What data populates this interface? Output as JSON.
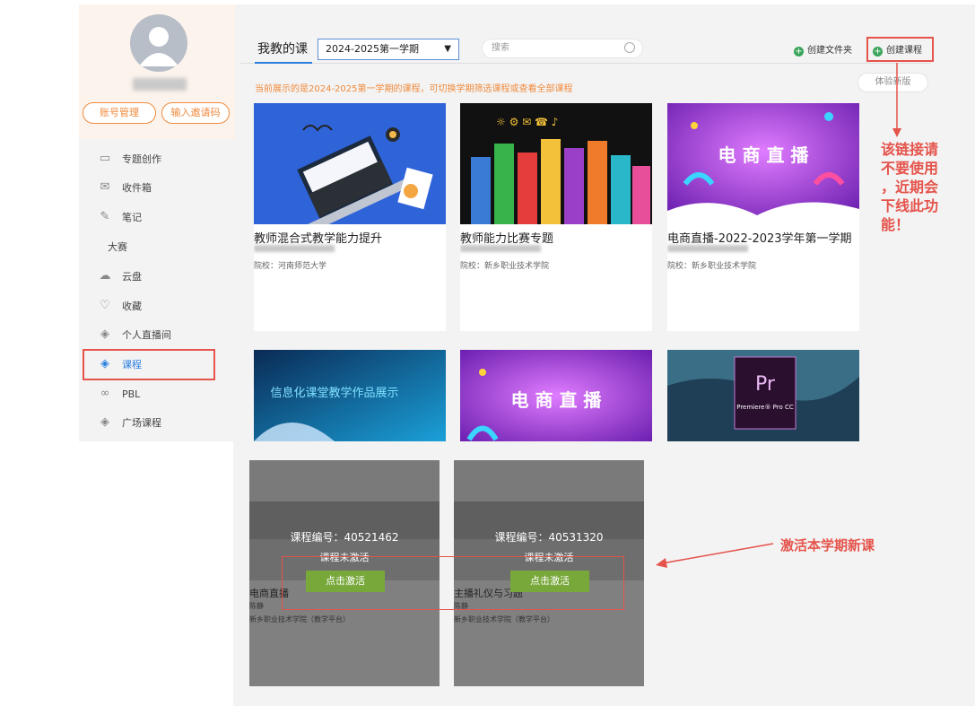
{
  "sidebar": {
    "account_btn": "账号管理",
    "invite_btn": "输入邀请码",
    "items": [
      {
        "label": "专题创作",
        "icon": "monitor-icon"
      },
      {
        "label": "收件箱",
        "icon": "inbox-icon"
      },
      {
        "label": "笔记",
        "icon": "note-icon"
      },
      {
        "label": "大赛",
        "icon": ""
      },
      {
        "label": "云盘",
        "icon": "cloud-icon"
      },
      {
        "label": "收藏",
        "icon": "heart-icon"
      },
      {
        "label": "个人直播间",
        "icon": "live-icon"
      },
      {
        "label": "课程",
        "icon": "course-icon"
      },
      {
        "label": "PBL",
        "icon": "group-icon"
      },
      {
        "label": "广场课程",
        "icon": "square-icon"
      }
    ]
  },
  "header": {
    "tab": "我教的课",
    "semester": "2024-2025第一学期",
    "search_placeholder": "搜索",
    "create_folder": "创建文件夹",
    "create_course": "创建课程",
    "notice": "当前展示的是2024-2025第一学期的课程，可切换学期筛选课程或查看全部课程",
    "try_new": "体验新版"
  },
  "courses": [
    {
      "title": "教师混合式教学能力提升",
      "school": "院校：河南师范大学"
    },
    {
      "title": "教师能力比赛专题",
      "school": "院校：新乡职业技术学院"
    },
    {
      "title": "电商直播-2022-2023学年第一学期",
      "school": "院校：新乡职业技术学院"
    }
  ],
  "course_images": {
    "card1": "",
    "card2": "",
    "card3": "电 商 直 播",
    "card4": "信息化课堂教学作品展示",
    "card5": "电 商 直 播",
    "card6_logo": "Pr",
    "card6_text": "Premiere® Pro CC"
  },
  "inactive_courses": [
    {
      "code": "课程编号：40521462",
      "status": "课程未激活",
      "button": "点击激活",
      "title": "电商直播",
      "teacher": "陈静",
      "school": "新乡职业技术学院（教学平台）"
    },
    {
      "code": "课程编号：40531320",
      "status": "课程未激活",
      "button": "点击激活",
      "title": "主播礼仪与习题",
      "teacher": "陈静",
      "school": "新乡职业技术学院（教学平台）"
    }
  ],
  "annotations": {
    "link_warning": [
      "该链接请",
      "不要使用",
      "，近期会",
      "下线此功",
      "能！"
    ],
    "activate_note": "激活本学期新课"
  },
  "colors": {
    "accent": "#2a7fe0",
    "orange": "#f08a3c",
    "red": "#e5534b",
    "green": "#78a83a"
  }
}
